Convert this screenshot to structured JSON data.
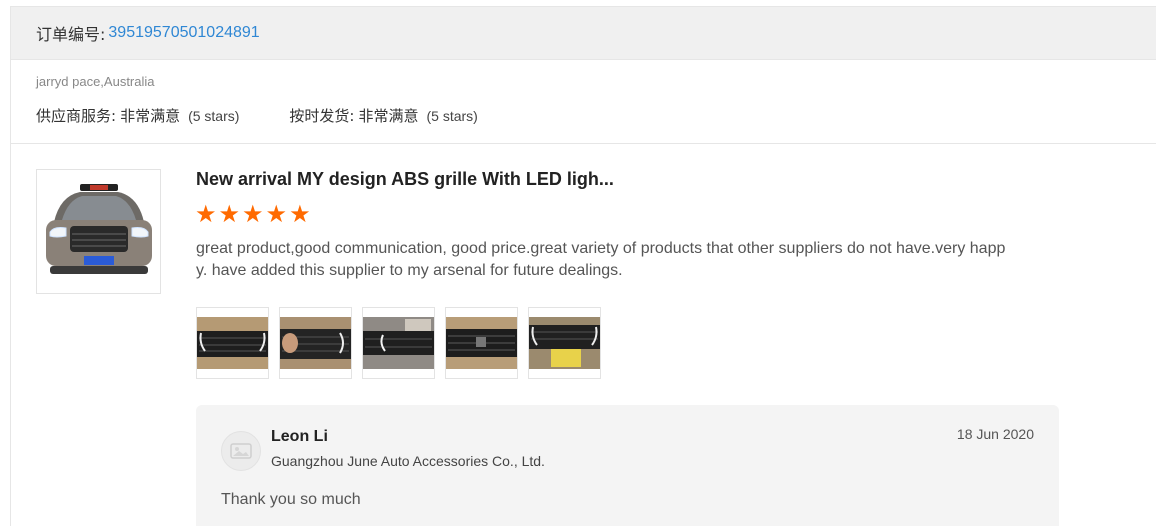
{
  "order": {
    "label": "订单编号:",
    "number": "39519570501024891"
  },
  "buyer": {
    "name": "jarryd pace,Australia",
    "ratings": [
      {
        "label": "供应商服务:",
        "value": "非常满意",
        "stars": "(5 stars)"
      },
      {
        "label": "按时发货:",
        "value": "非常满意",
        "stars": "(5 stars)"
      }
    ]
  },
  "product": {
    "image_icon": "car-front-grille-image",
    "title": "New arrival MY design ABS grille With LED ligh...",
    "rating_stars": 5,
    "star_color": "#ff6a00",
    "review": "great product,good communication, good price.great variety of products that other suppliers do not have.very happy. have added this supplier to my arsenal for future dealings.",
    "photos": [
      "grille-photo",
      "grille-photo",
      "grille-photo",
      "grille-photo",
      "grille-photo"
    ]
  },
  "reply": {
    "avatar_icon": "avatar-placeholder-icon",
    "name": "Leon Li",
    "company": "Guangzhou June Auto Accessories Co., Ltd.",
    "date": "18 Jun 2020",
    "text": "Thank you so much"
  },
  "colors": {
    "link": "#2f87d4",
    "header_bg": "#f0f0f0",
    "reply_bg": "#f4f4f4"
  }
}
